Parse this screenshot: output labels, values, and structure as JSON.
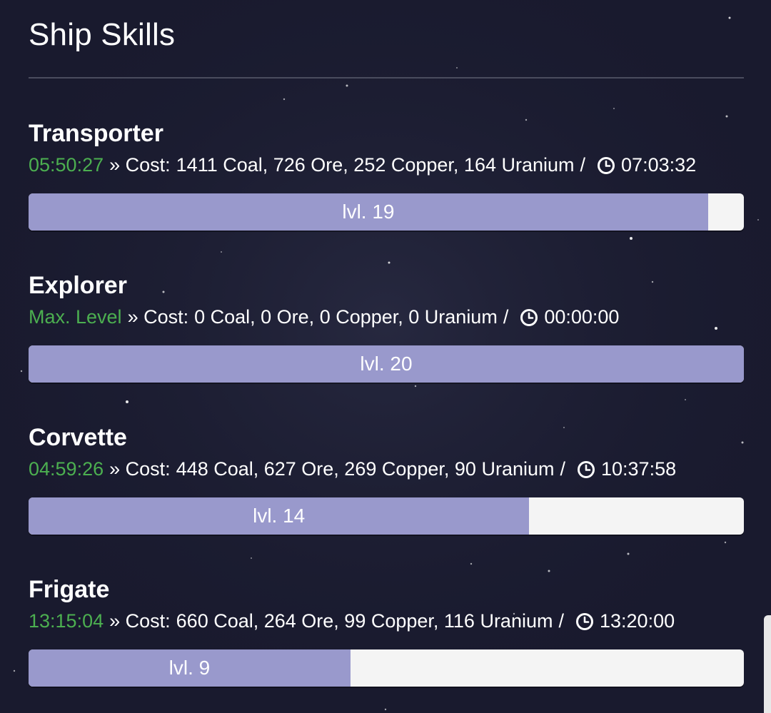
{
  "page": {
    "title": "Ship Skills"
  },
  "labels": {
    "cost_prefix": "» Cost:",
    "separator": "/"
  },
  "colors": {
    "background": "#191a2e",
    "timer_green": "#4caf50",
    "progress_fill": "#9999cc",
    "progress_track": "#f4f4f4"
  },
  "skills": [
    {
      "name": "Transporter",
      "status": "05:50:27",
      "cost": "1411 Coal, 726 Ore, 252 Copper, 164 Uranium",
      "icon": "clock-icon",
      "duration": "07:03:32",
      "level_label": "lvl. 19",
      "progress": 0.95
    },
    {
      "name": "Explorer",
      "status": "Max. Level",
      "cost": "0 Coal, 0 Ore, 0 Copper, 0 Uranium",
      "icon": "clock-icon",
      "duration": "00:00:00",
      "level_label": "lvl. 20",
      "progress": 1.0
    },
    {
      "name": "Corvette",
      "status": "04:59:26",
      "cost": "448 Coal, 627 Ore, 269 Copper, 90 Uranium",
      "icon": "clock-icon",
      "duration": "10:37:58",
      "level_label": "lvl. 14",
      "progress": 0.7
    },
    {
      "name": "Frigate",
      "status": "13:15:04",
      "cost": "660 Coal, 264 Ore, 99 Copper, 116 Uranium",
      "icon": "clock-icon",
      "duration": "13:20:00",
      "level_label": "lvl. 9",
      "progress": 0.45
    }
  ]
}
